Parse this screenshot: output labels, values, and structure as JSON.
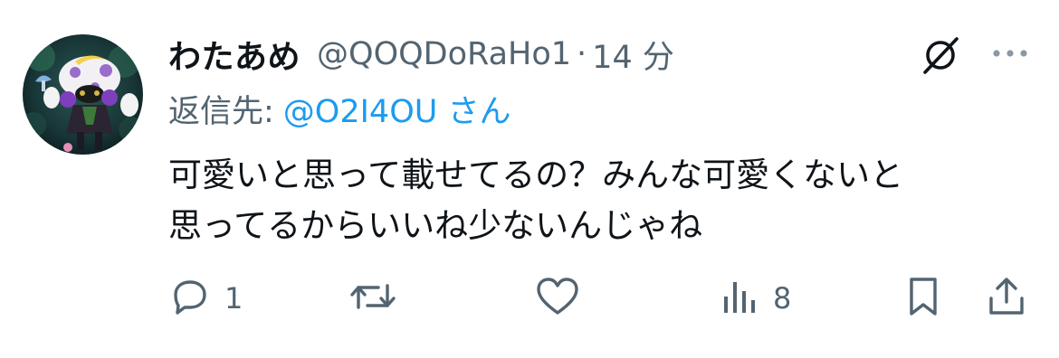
{
  "author": {
    "display_name": "わたあめ",
    "handle": "@QOQDoRaHo1",
    "separator": "·",
    "time": "14 分"
  },
  "reply": {
    "prefix": "返信先:",
    "target": "@O2I4OU さん"
  },
  "body": {
    "line1": "可愛いと思って載せてるの？みんな可愛くないと",
    "line2": "思ってるからいいね少ないんじゃね"
  },
  "actions": {
    "reply_count": "1",
    "repost_count": "",
    "like_count": "",
    "views_count": "8"
  },
  "icons": {
    "grok": "grok-icon",
    "more": "more-icon",
    "reply": "reply-icon",
    "repost": "repost-icon",
    "like": "heart-icon",
    "views": "views-icon",
    "bookmark": "bookmark-icon",
    "share": "share-icon"
  },
  "colors": {
    "text_primary": "#0f1419",
    "text_secondary": "#536471",
    "link": "#1d9bf0"
  }
}
